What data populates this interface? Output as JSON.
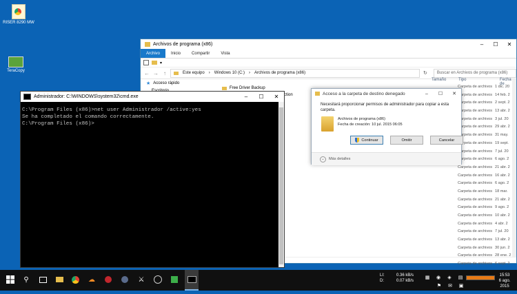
{
  "desktop": {
    "icons": [
      {
        "label": "RISER 8290 MW"
      },
      {
        "label": "TeraCopy"
      }
    ]
  },
  "explorer": {
    "title": "Archivos de programa (x86)",
    "ribbon_tabs": [
      "Archivo",
      "Inicio",
      "Compartir",
      "Vista"
    ],
    "address": [
      "Este equipo",
      "Windows 10 (C:)",
      "Archivos de programa (x86)"
    ],
    "search_placeholder": "Buscar en Archivos de programa (x86)",
    "columns": {
      "size": "Tamaño",
      "type": "Tipo",
      "date": "Fecha de"
    },
    "nav": {
      "quick_access": "Acceso rápido",
      "desktop": "Escritorio"
    },
    "files": [
      "Free Driver Backup"
    ],
    "partial_text": "ction",
    "rows": [
      {
        "type": "Carpeta de archivos",
        "date": "1 dic. 20"
      },
      {
        "type": "Carpeta de archivos",
        "date": "14 feb. 2"
      },
      {
        "type": "Carpeta de archivos",
        "date": "2 sept. 2"
      },
      {
        "type": "Carpeta de archivos",
        "date": "13 abr. 2"
      },
      {
        "type": "Carpeta de archivos",
        "date": "3 jul. 20"
      },
      {
        "type": "Carpeta de archivos",
        "date": "29 abr. 2"
      },
      {
        "type": "Carpeta de archivos",
        "date": "31 may."
      },
      {
        "type": "Carpeta de archivos",
        "date": "19 sept."
      },
      {
        "type": "Carpeta de archivos",
        "date": "7 jul. 20"
      },
      {
        "type": "Carpeta de archivos",
        "date": "6 ago. 2"
      },
      {
        "type": "Carpeta de archivos",
        "date": "21 abr. 2"
      },
      {
        "type": "Carpeta de archivos",
        "date": "16 abr. 2"
      },
      {
        "type": "Carpeta de archivos",
        "date": "6 ago. 2"
      },
      {
        "type": "Carpeta de archivos",
        "date": "18 mar."
      },
      {
        "type": "Carpeta de archivos",
        "date": "21 abr. 2"
      },
      {
        "type": "Carpeta de archivos",
        "date": "9 ago. 2"
      },
      {
        "type": "Carpeta de archivos",
        "date": "10 abr. 2"
      },
      {
        "type": "Carpeta de archivos",
        "date": "4 abr. 2"
      },
      {
        "type": "Carpeta de archivos",
        "date": "7 jul. 20"
      },
      {
        "type": "Carpeta de archivos",
        "date": "13 abr. 2"
      },
      {
        "type": "Carpeta de archivos",
        "date": "30 jun. 2"
      },
      {
        "type": "Carpeta de archivos",
        "date": "28 ene. 2"
      },
      {
        "type": "Carpeta de archivos",
        "date": "6 sept. 2"
      },
      {
        "type": "Carpeta de archivos",
        "date": "6 ago. 2"
      },
      {
        "type": "Carpeta de archivos",
        "date": "13 abr. 2"
      },
      {
        "type": "Carpeta de archivos",
        "date": "14 jul. 20"
      }
    ]
  },
  "dialog": {
    "title": "Acceso a la carpeta de destino denegado",
    "message": "Necesitará proporcionar permisos de administrador para copiar a esta carpeta.",
    "file_name": "Archivos de programa (x86)",
    "file_date": "Fecha de creación: 10 jul. 2015 06:05",
    "buttons": {
      "continue": "Continuar",
      "skip": "Omitir",
      "cancel": "Cancelar"
    },
    "more": "Más detalles"
  },
  "cmd": {
    "title": "Administrador: C:\\WINDOWS\\system32\\cmd.exe",
    "lines": [
      "C:\\Program Files (x86)>net user Administrador /active:yes",
      "Se ha completado el comando correctamente.",
      "",
      "",
      "C:\\Program Files (x86)>"
    ]
  },
  "taskbar": {
    "lang": "LI:",
    "lang2": "D:",
    "up_speed": "0.36 kB/s",
    "down_speed": "0.07 kB/s",
    "time": "15:53",
    "date": "6 ago. 2015"
  },
  "colors": {
    "desktop": "#0b63b5",
    "accent": "#1979ca",
    "cmd_bg": "#000000"
  }
}
